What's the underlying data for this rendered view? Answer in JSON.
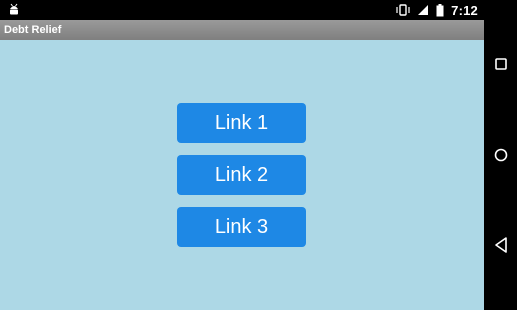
{
  "status_bar": {
    "time": "7:12",
    "icons": [
      "android-debug-icon",
      "vibrate-icon",
      "signal-icon",
      "battery-icon"
    ]
  },
  "app": {
    "title": "Debt Relief"
  },
  "links": [
    {
      "label": "Link 1"
    },
    {
      "label": "Link 2"
    },
    {
      "label": "Link 3"
    }
  ],
  "nav_bar": {
    "icons": [
      "recent-apps-icon",
      "home-icon",
      "back-icon"
    ]
  },
  "colors": {
    "background": "#add8e6",
    "button": "#1e88e5",
    "title_bar": "#8c8c8c"
  }
}
